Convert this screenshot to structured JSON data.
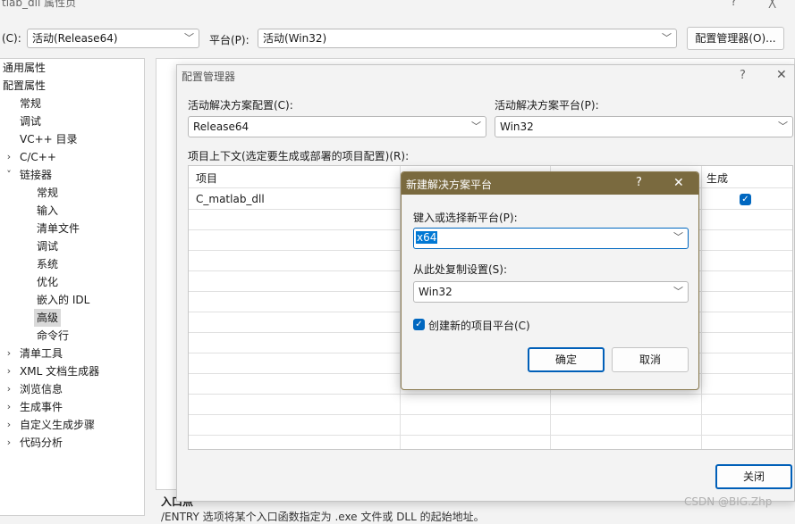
{
  "window": {
    "title": "tlab_dll 属性页",
    "help": "?",
    "close": "╳"
  },
  "toolbar": {
    "config_label": "(C):",
    "config_value": "活动(Release64)",
    "platform_label": "平台(P):",
    "platform_value": "活动(Win32)",
    "config_manager_button": "配置管理器(O)..."
  },
  "tree": {
    "items": [
      {
        "label": "通用属性"
      },
      {
        "label": "配置属性"
      },
      {
        "label": "常规"
      },
      {
        "label": "调试"
      },
      {
        "label": "VC++ 目录"
      },
      {
        "label": "C/C++"
      },
      {
        "label": "链接器"
      },
      {
        "label": "常规"
      },
      {
        "label": "输入"
      },
      {
        "label": "清单文件"
      },
      {
        "label": "调试"
      },
      {
        "label": "系统"
      },
      {
        "label": "优化"
      },
      {
        "label": "嵌入的 IDL"
      },
      {
        "label": "高级"
      },
      {
        "label": "命令行"
      },
      {
        "label": "清单工具"
      },
      {
        "label": "XML 文档生成器"
      },
      {
        "label": "浏览信息"
      },
      {
        "label": "生成事件"
      },
      {
        "label": "自定义生成步骤"
      },
      {
        "label": "代码分析"
      }
    ]
  },
  "background": {
    "entry_title": "入口点",
    "entry_desc": "/ENTRY 选项将某个入口函数指定为 .exe 文件或 DLL 的起始地址。"
  },
  "config_manager": {
    "title": "配置管理器",
    "help": "?",
    "close": "✕",
    "active_solution_config_label": "活动解决方案配置(C):",
    "active_solution_config_value": "Release64",
    "active_solution_platform_label": "活动解决方案平台(P):",
    "active_solution_platform_value": "Win32",
    "project_context_label": "项目上下文(选定要生成或部署的项目配置)(R):",
    "columns": {
      "project": "项目",
      "build": "生成"
    },
    "rows": [
      {
        "project": "C_matlab_dll",
        "build": true
      }
    ],
    "close_button": "关闭"
  },
  "new_platform_dialog": {
    "title": "新建解决方案平台",
    "help": "?",
    "close": "✕",
    "platform_label": "键入或选择新平台(P):",
    "platform_value": "x64",
    "copy_label": "从此处复制设置(S):",
    "copy_value": "Win32",
    "create_project_platform_label": "创建新的项目平台(C)",
    "create_project_platform_checked": true,
    "ok_button": "确定",
    "cancel_button": "取消"
  },
  "watermark": "CSDN @BIG.Zhp",
  "colors": {
    "accent": "#0067c0",
    "dialog_titlebar": "#7a6a3f",
    "selection": "#0078d4"
  }
}
